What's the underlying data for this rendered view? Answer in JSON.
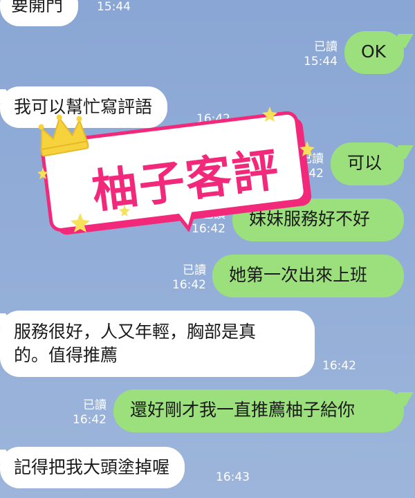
{
  "messages": [
    {
      "id": "m1",
      "side": "in",
      "text": "要開門",
      "time": "15:44"
    },
    {
      "id": "m2",
      "side": "out",
      "text": "OK",
      "read": "已讀",
      "time": "15:44"
    },
    {
      "id": "m3",
      "side": "in",
      "text": "我可以幫忙寫評語",
      "time": "16:42"
    },
    {
      "id": "m4",
      "side": "out",
      "text": "可以",
      "read": "已讀",
      "time": "16:42"
    },
    {
      "id": "m5",
      "side": "out",
      "text": "妹妹服務好不好",
      "read": "已讀",
      "time": "16:42"
    },
    {
      "id": "m6",
      "side": "out",
      "text": "她第一次出來上班",
      "read": "已讀",
      "time": "16:42"
    },
    {
      "id": "m7",
      "side": "in",
      "line1": "服務很好，人又年輕，胸部是真",
      "line2": "的。值得推薦",
      "time": "16:42"
    },
    {
      "id": "m8",
      "side": "out",
      "text": "還好剛才我一直推薦柚子給你",
      "read": "已讀",
      "time": "16:42"
    },
    {
      "id": "m9",
      "side": "in",
      "text": "記得把我大頭塗掉喔",
      "time": "16:43"
    }
  ],
  "watermark": {
    "text": "柚子客評",
    "icon": "crown-icon",
    "colors": {
      "frame": "#f2297a",
      "fill": "#ffffff",
      "star": "#f7e15a",
      "crown": "#f6d23c"
    }
  },
  "colors": {
    "background": "#8aa6d4",
    "incoming_bubble": "#ffffff",
    "outgoing_bubble": "#9be07c",
    "meta_text": "#ffffff"
  }
}
